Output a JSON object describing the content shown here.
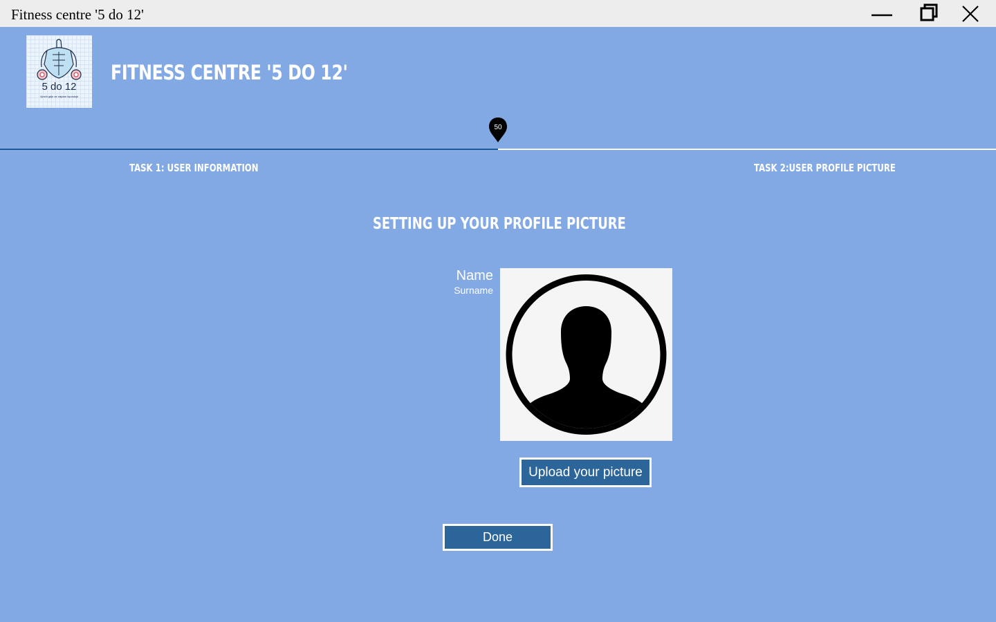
{
  "window": {
    "title": "Fitness centre '5 do 12'",
    "controls": [
      "minimize-icon",
      "restore-icon",
      "close-icon"
    ]
  },
  "header": {
    "logo_text": "5 do 12",
    "logo_tagline": "Vjezbi gdje se najvise ispostuje",
    "app_title": "Fitness centre '5 do 12'"
  },
  "progress": {
    "value": 50,
    "fraction": 0.5,
    "label": "50"
  },
  "tasks": [
    {
      "label": "TASK 1: USER INFORMATION"
    },
    {
      "label": "TASK 2:USER PROFILE PICTURE"
    }
  ],
  "main": {
    "heading": "SETTING UP YOUR PROFILE PICTURE",
    "name": "Name",
    "surname": "Surname",
    "avatar_icon": "user-silhouette-icon",
    "upload_label": "Upload your picture",
    "done_label": "Done"
  },
  "colors": {
    "background": "#82a9e4",
    "button": "#2b6599",
    "progress_fill": "#1c5a9a",
    "titlebar": "#ededed"
  }
}
